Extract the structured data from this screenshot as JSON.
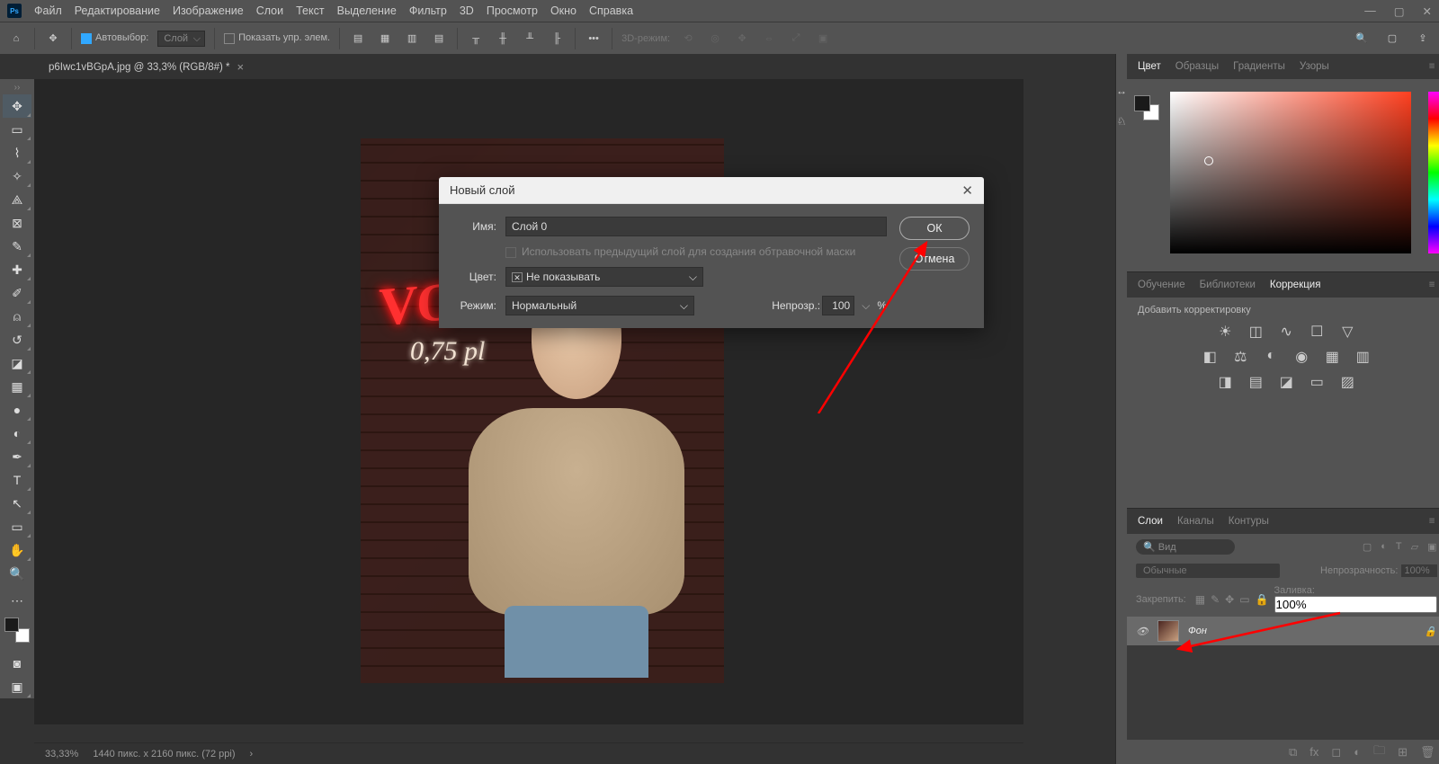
{
  "menu": {
    "items": [
      "Файл",
      "Редактирование",
      "Изображение",
      "Слои",
      "Текст",
      "Выделение",
      "Фильтр",
      "3D",
      "Просмотр",
      "Окно",
      "Справка"
    ]
  },
  "optionbar": {
    "autoSelect": "Автовыбор:",
    "autoSelectTarget": "Слой",
    "showTransform": "Показать упр. элем.",
    "mode3d": "3D-режим:"
  },
  "tab": {
    "name": "p6Iwc1vBGpA.jpg @ 33,3% (RGB/8#) *"
  },
  "dialog": {
    "title": "Новый слой",
    "nameLabel": "Имя:",
    "nameValue": "Слой 0",
    "clipMask": "Использовать предыдущий слой для создания обтравочной маски",
    "colorLabel": "Цвет:",
    "colorValue": "Не показывать",
    "modeLabel": "Режим:",
    "modeValue": "Нормальный",
    "opacityLabel": "Непрозр.:",
    "opacityValue": "100",
    "pct": "%",
    "ok": "ОК",
    "cancel": "Отмена"
  },
  "colorPanel": {
    "tabs": [
      "Цвет",
      "Образцы",
      "Градиенты",
      "Узоры"
    ]
  },
  "learnPanel": {
    "tabs": [
      "Обучение",
      "Библиотеки",
      "Коррекция"
    ],
    "hint": "Добавить корректировку"
  },
  "layersPanel": {
    "tabs": [
      "Слои",
      "Каналы",
      "Контуры"
    ],
    "searchPlaceholder": "Вид",
    "blend": "Обычные",
    "opacityLabel": "Непрозрачность:",
    "opacityValue": "100%",
    "lockLabel": "Закрепить:",
    "fillLabel": "Заливка:",
    "fillValue": "100%",
    "layer0": "Фон"
  },
  "status": {
    "zoom": "33,33%",
    "dims": "1440 пикс. x 2160 пикс. (72 ppi)"
  },
  "neon": {
    "big": "VO",
    "sub": "0,75 pl"
  }
}
